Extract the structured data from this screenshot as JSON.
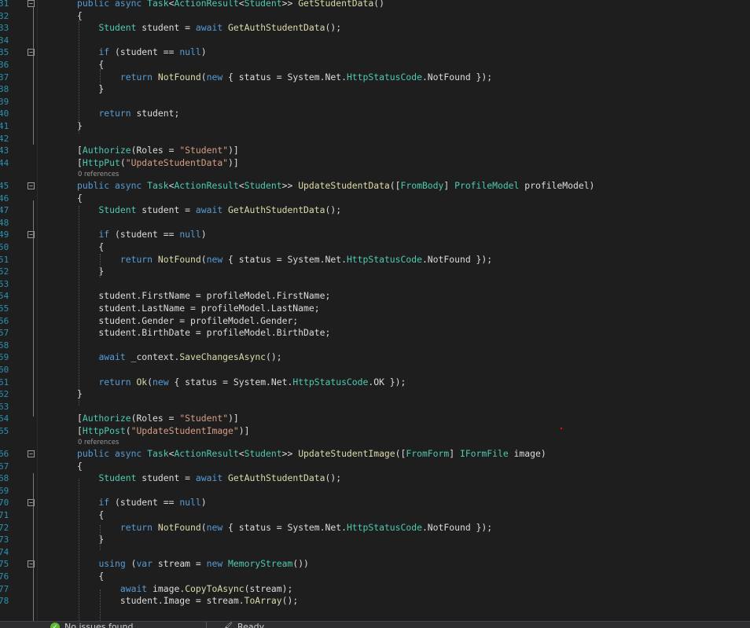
{
  "colors": {
    "background": "#1e1e1e",
    "keyword": "#569cd6",
    "type": "#4ec9b0",
    "method": "#dcdcaa",
    "string": "#d69d85",
    "line_number": "#2b91af",
    "plain": "#dcdcdc"
  },
  "icons": [
    "fold-minus-icon",
    "issues-ok-icon",
    "brush-icon"
  ],
  "code_lines": [
    {
      "ln": "31",
      "fold": true,
      "tokens": [
        {
          "t": "public async ",
          "c": "kw"
        },
        {
          "t": "Task",
          "c": "ty"
        },
        {
          "t": "<",
          "c": "pl"
        },
        {
          "t": "ActionResult",
          "c": "ty"
        },
        {
          "t": "<",
          "c": "pl"
        },
        {
          "t": "Student",
          "c": "ty"
        },
        {
          "t": ">> ",
          "c": "pl"
        },
        {
          "t": "GetStudentData",
          "c": "fn"
        },
        {
          "t": "()",
          "c": "pl"
        }
      ]
    },
    {
      "ln": "32",
      "tokens": [
        {
          "t": "{",
          "c": "pl"
        }
      ]
    },
    {
      "ln": "33",
      "tokens": [
        {
          "t": "    ",
          "c": "pl"
        },
        {
          "t": "Student",
          "c": "ty"
        },
        {
          "t": " student = ",
          "c": "pl"
        },
        {
          "t": "await",
          "c": "kw"
        },
        {
          "t": " ",
          "c": "pl"
        },
        {
          "t": "GetAuthStudentData",
          "c": "fn"
        },
        {
          "t": "();",
          "c": "pl"
        }
      ]
    },
    {
      "ln": "34",
      "tokens": []
    },
    {
      "ln": "35",
      "fold": true,
      "tokens": [
        {
          "t": "    ",
          "c": "pl"
        },
        {
          "t": "if",
          "c": "kw"
        },
        {
          "t": " (student == ",
          "c": "pl"
        },
        {
          "t": "null",
          "c": "kw"
        },
        {
          "t": ")",
          "c": "pl"
        }
      ]
    },
    {
      "ln": "36",
      "tokens": [
        {
          "t": "    {",
          "c": "pl"
        }
      ]
    },
    {
      "ln": "37",
      "tokens": [
        {
          "t": "        ",
          "c": "pl"
        },
        {
          "t": "return",
          "c": "kw"
        },
        {
          "t": " ",
          "c": "pl"
        },
        {
          "t": "NotFound",
          "c": "fn"
        },
        {
          "t": "(",
          "c": "pl"
        },
        {
          "t": "new",
          "c": "kw"
        },
        {
          "t": " { status = System.Net.",
          "c": "pl"
        },
        {
          "t": "HttpStatusCode",
          "c": "ty"
        },
        {
          "t": ".NotFound });",
          "c": "pl"
        }
      ]
    },
    {
      "ln": "38",
      "tokens": [
        {
          "t": "    }",
          "c": "pl"
        }
      ]
    },
    {
      "ln": "39",
      "tokens": []
    },
    {
      "ln": "40",
      "tokens": [
        {
          "t": "    ",
          "c": "pl"
        },
        {
          "t": "return",
          "c": "kw"
        },
        {
          "t": " student;",
          "c": "pl"
        }
      ]
    },
    {
      "ln": "41",
      "tokens": [
        {
          "t": "}",
          "c": "pl"
        }
      ]
    },
    {
      "ln": "42",
      "tokens": []
    },
    {
      "ln": "43",
      "tokens": [
        {
          "t": "[",
          "c": "pl"
        },
        {
          "t": "Authorize",
          "c": "ty"
        },
        {
          "t": "(Roles = ",
          "c": "pl"
        },
        {
          "t": "\"Student\"",
          "c": "st"
        },
        {
          "t": ")]",
          "c": "pl"
        }
      ]
    },
    {
      "ln": "44",
      "refs": "0 references",
      "tokens": [
        {
          "t": "[",
          "c": "pl"
        },
        {
          "t": "HttpPut",
          "c": "ty"
        },
        {
          "t": "(",
          "c": "pl"
        },
        {
          "t": "\"UpdateStudentData\"",
          "c": "st"
        },
        {
          "t": ")]",
          "c": "pl"
        }
      ]
    },
    {
      "ln": "45",
      "fold": true,
      "tokens": [
        {
          "t": "public async ",
          "c": "kw"
        },
        {
          "t": "Task",
          "c": "ty"
        },
        {
          "t": "<",
          "c": "pl"
        },
        {
          "t": "ActionResult",
          "c": "ty"
        },
        {
          "t": "<",
          "c": "pl"
        },
        {
          "t": "Student",
          "c": "ty"
        },
        {
          "t": ">> ",
          "c": "pl"
        },
        {
          "t": "UpdateStudentData",
          "c": "fn"
        },
        {
          "t": "([",
          "c": "pl"
        },
        {
          "t": "FromBody",
          "c": "ty"
        },
        {
          "t": "] ",
          "c": "pl"
        },
        {
          "t": "ProfileModel",
          "c": "ty"
        },
        {
          "t": " profileModel)",
          "c": "pl"
        }
      ]
    },
    {
      "ln": "46",
      "tokens": [
        {
          "t": "{",
          "c": "pl"
        }
      ]
    },
    {
      "ln": "47",
      "tokens": [
        {
          "t": "    ",
          "c": "pl"
        },
        {
          "t": "Student",
          "c": "ty"
        },
        {
          "t": " student = ",
          "c": "pl"
        },
        {
          "t": "await",
          "c": "kw"
        },
        {
          "t": " ",
          "c": "pl"
        },
        {
          "t": "GetAuthStudentData",
          "c": "fn"
        },
        {
          "t": "();",
          "c": "pl"
        }
      ]
    },
    {
      "ln": "48",
      "tokens": []
    },
    {
      "ln": "49",
      "fold": true,
      "tokens": [
        {
          "t": "    ",
          "c": "pl"
        },
        {
          "t": "if",
          "c": "kw"
        },
        {
          "t": " (student == ",
          "c": "pl"
        },
        {
          "t": "null",
          "c": "kw"
        },
        {
          "t": ")",
          "c": "pl"
        }
      ]
    },
    {
      "ln": "50",
      "tokens": [
        {
          "t": "    {",
          "c": "pl"
        }
      ]
    },
    {
      "ln": "51",
      "tokens": [
        {
          "t": "        ",
          "c": "pl"
        },
        {
          "t": "return",
          "c": "kw"
        },
        {
          "t": " ",
          "c": "pl"
        },
        {
          "t": "NotFound",
          "c": "fn"
        },
        {
          "t": "(",
          "c": "pl"
        },
        {
          "t": "new",
          "c": "kw"
        },
        {
          "t": " { status = System.Net.",
          "c": "pl"
        },
        {
          "t": "HttpStatusCode",
          "c": "ty"
        },
        {
          "t": ".NotFound });",
          "c": "pl"
        }
      ]
    },
    {
      "ln": "52",
      "tokens": [
        {
          "t": "    }",
          "c": "pl"
        }
      ]
    },
    {
      "ln": "53",
      "tokens": []
    },
    {
      "ln": "54",
      "tokens": [
        {
          "t": "    student.FirstName = profileModel.FirstName;",
          "c": "pl"
        }
      ]
    },
    {
      "ln": "55",
      "tokens": [
        {
          "t": "    student.LastName = profileModel.LastName;",
          "c": "pl"
        }
      ]
    },
    {
      "ln": "56",
      "tokens": [
        {
          "t": "    student.Gender = profileModel.Gender;",
          "c": "pl"
        }
      ]
    },
    {
      "ln": "57",
      "tokens": [
        {
          "t": "    student.BirthDate = profileModel.BirthDate;",
          "c": "pl"
        }
      ]
    },
    {
      "ln": "58",
      "tokens": []
    },
    {
      "ln": "59",
      "tokens": [
        {
          "t": "    ",
          "c": "pl"
        },
        {
          "t": "await",
          "c": "kw"
        },
        {
          "t": " _context.",
          "c": "pl"
        },
        {
          "t": "SaveChangesAsync",
          "c": "fn"
        },
        {
          "t": "();",
          "c": "pl"
        }
      ]
    },
    {
      "ln": "60",
      "tokens": []
    },
    {
      "ln": "61",
      "tokens": [
        {
          "t": "    ",
          "c": "pl"
        },
        {
          "t": "return",
          "c": "kw"
        },
        {
          "t": " ",
          "c": "pl"
        },
        {
          "t": "Ok",
          "c": "fn"
        },
        {
          "t": "(",
          "c": "pl"
        },
        {
          "t": "new",
          "c": "kw"
        },
        {
          "t": " { status = System.Net.",
          "c": "pl"
        },
        {
          "t": "HttpStatusCode",
          "c": "ty"
        },
        {
          "t": ".OK });",
          "c": "pl"
        }
      ]
    },
    {
      "ln": "62",
      "tokens": [
        {
          "t": "}",
          "c": "pl"
        }
      ]
    },
    {
      "ln": "63",
      "tokens": []
    },
    {
      "ln": "64",
      "tokens": [
        {
          "t": "[",
          "c": "pl"
        },
        {
          "t": "Authorize",
          "c": "ty"
        },
        {
          "t": "(Roles = ",
          "c": "pl"
        },
        {
          "t": "\"Student\"",
          "c": "st"
        },
        {
          "t": ")]",
          "c": "pl"
        }
      ]
    },
    {
      "ln": "65",
      "refs": "0 references",
      "tokens": [
        {
          "t": "[",
          "c": "pl"
        },
        {
          "t": "HttpPost",
          "c": "ty"
        },
        {
          "t": "(",
          "c": "pl"
        },
        {
          "t": "\"UpdateStudentImage\"",
          "c": "st"
        },
        {
          "t": ")]",
          "c": "pl"
        }
      ]
    },
    {
      "ln": "66",
      "fold": true,
      "tokens": [
        {
          "t": "public async ",
          "c": "kw"
        },
        {
          "t": "Task",
          "c": "ty"
        },
        {
          "t": "<",
          "c": "pl"
        },
        {
          "t": "ActionResult",
          "c": "ty"
        },
        {
          "t": "<",
          "c": "pl"
        },
        {
          "t": "Student",
          "c": "ty"
        },
        {
          "t": ">> ",
          "c": "pl"
        },
        {
          "t": "UpdateStudentImage",
          "c": "fn"
        },
        {
          "t": "([",
          "c": "pl"
        },
        {
          "t": "FromForm",
          "c": "ty"
        },
        {
          "t": "] ",
          "c": "pl"
        },
        {
          "t": "IFormFile",
          "c": "ty"
        },
        {
          "t": " image)",
          "c": "pl"
        }
      ]
    },
    {
      "ln": "67",
      "tokens": [
        {
          "t": "{",
          "c": "pl"
        }
      ]
    },
    {
      "ln": "68",
      "tokens": [
        {
          "t": "    ",
          "c": "pl"
        },
        {
          "t": "Student",
          "c": "ty"
        },
        {
          "t": " student = ",
          "c": "pl"
        },
        {
          "t": "await",
          "c": "kw"
        },
        {
          "t": " ",
          "c": "pl"
        },
        {
          "t": "GetAuthStudentData",
          "c": "fn"
        },
        {
          "t": "();",
          "c": "pl"
        }
      ]
    },
    {
      "ln": "69",
      "tokens": []
    },
    {
      "ln": "70",
      "fold": true,
      "tokens": [
        {
          "t": "    ",
          "c": "pl"
        },
        {
          "t": "if",
          "c": "kw"
        },
        {
          "t": " (student == ",
          "c": "pl"
        },
        {
          "t": "null",
          "c": "kw"
        },
        {
          "t": ")",
          "c": "pl"
        }
      ]
    },
    {
      "ln": "71",
      "tokens": [
        {
          "t": "    {",
          "c": "pl"
        }
      ]
    },
    {
      "ln": "72",
      "tokens": [
        {
          "t": "        ",
          "c": "pl"
        },
        {
          "t": "return",
          "c": "kw"
        },
        {
          "t": " ",
          "c": "pl"
        },
        {
          "t": "NotFound",
          "c": "fn"
        },
        {
          "t": "(",
          "c": "pl"
        },
        {
          "t": "new",
          "c": "kw"
        },
        {
          "t": " { status = System.Net.",
          "c": "pl"
        },
        {
          "t": "HttpStatusCode",
          "c": "ty"
        },
        {
          "t": ".NotFound });",
          "c": "pl"
        }
      ]
    },
    {
      "ln": "73",
      "tokens": [
        {
          "t": "    }",
          "c": "pl"
        }
      ]
    },
    {
      "ln": "74",
      "tokens": []
    },
    {
      "ln": "75",
      "fold": true,
      "tokens": [
        {
          "t": "    ",
          "c": "pl"
        },
        {
          "t": "using",
          "c": "kw"
        },
        {
          "t": " (",
          "c": "pl"
        },
        {
          "t": "var",
          "c": "kw"
        },
        {
          "t": " stream = ",
          "c": "pl"
        },
        {
          "t": "new",
          "c": "kw"
        },
        {
          "t": " ",
          "c": "pl"
        },
        {
          "t": "MemoryStream",
          "c": "ty"
        },
        {
          "t": "())",
          "c": "pl"
        }
      ]
    },
    {
      "ln": "76",
      "tokens": [
        {
          "t": "    {",
          "c": "pl"
        }
      ]
    },
    {
      "ln": "77",
      "tokens": [
        {
          "t": "        ",
          "c": "pl"
        },
        {
          "t": "await",
          "c": "kw"
        },
        {
          "t": " image.",
          "c": "pl"
        },
        {
          "t": "CopyToAsync",
          "c": "fn"
        },
        {
          "t": "(stream);",
          "c": "pl"
        }
      ]
    },
    {
      "ln": "78",
      "tokens": [
        {
          "t": "        student.Image = stream.",
          "c": "pl"
        },
        {
          "t": "ToArray",
          "c": "fn"
        },
        {
          "t": "();",
          "c": "pl"
        }
      ]
    }
  ],
  "status": {
    "issues": "No issues found",
    "right_label": "Ready"
  }
}
